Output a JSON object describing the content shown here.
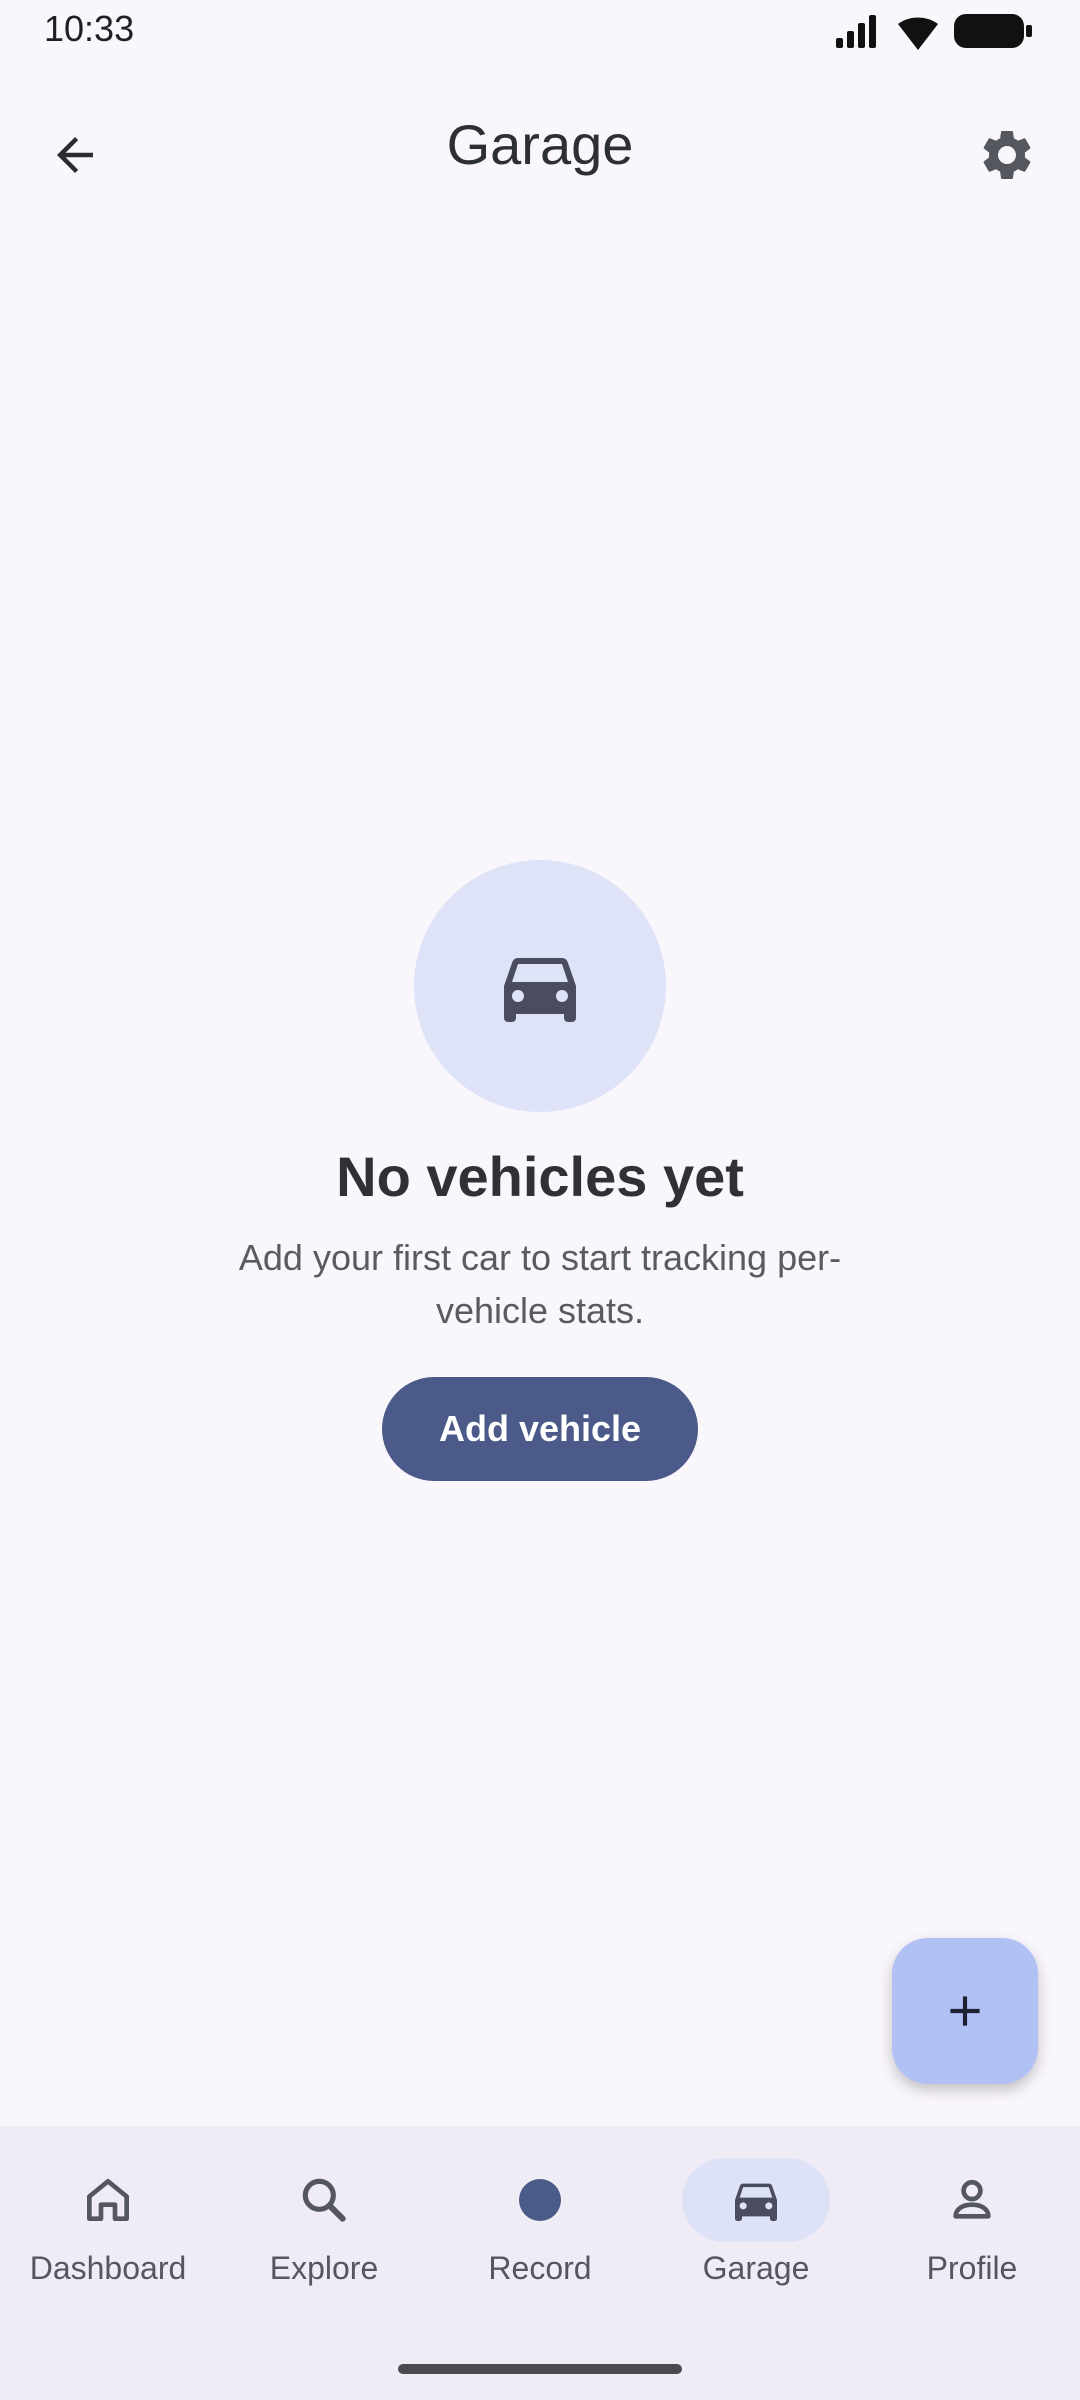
{
  "status_bar": {
    "time": "10:33",
    "icons": [
      "signal-icon",
      "wifi-icon",
      "battery-icon"
    ]
  },
  "app_bar": {
    "title": "Garage",
    "back_icon": "arrow-back-icon",
    "settings_icon": "gear-icon"
  },
  "empty_state": {
    "icon": "car-icon",
    "title": "No vehicles yet",
    "description": "Add your first car to start tracking per-vehicle stats.",
    "button_label": "Add vehicle"
  },
  "fab": {
    "icon": "plus-icon"
  },
  "bottom_nav": {
    "items": [
      {
        "label": "Dashboard",
        "icon": "home-icon",
        "active": false
      },
      {
        "label": "Explore",
        "icon": "search-icon",
        "active": false
      },
      {
        "label": "Record",
        "icon": "record-dot-icon",
        "active": false
      },
      {
        "label": "Garage",
        "icon": "car-icon",
        "active": true
      },
      {
        "label": "Profile",
        "icon": "person-icon",
        "active": false
      }
    ]
  },
  "colors": {
    "background": "#f9f6fc",
    "primary": "#4b5a88",
    "fab": "#b1c1f4",
    "circle": "#dfe3f7",
    "nav_bar": "#efecf5",
    "nav_active_pill": "#dde2f7"
  }
}
